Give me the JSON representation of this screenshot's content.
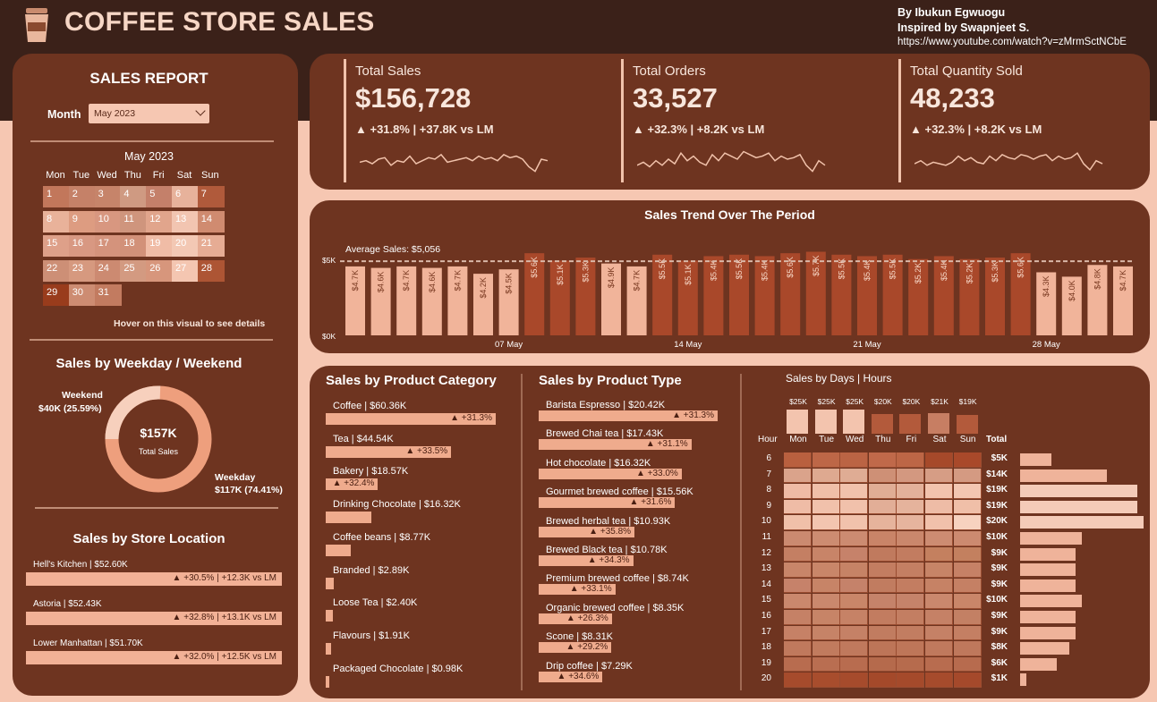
{
  "header": {
    "title": "COFFEE STORE SALES",
    "credit_author": "By Ibukun Egwuogu",
    "credit_inspired": "Inspired by Swapnjeet S.",
    "credit_url": "https://www.youtube.com/watch?v=zMrmSctNCbE",
    "logo_icon": "coffee-cup-icon"
  },
  "report": {
    "title": "SALES REPORT",
    "month_label": "Month",
    "month_value": "May 2023"
  },
  "calendar": {
    "title": "May 2023",
    "weekdays": [
      "Mon",
      "Tue",
      "Wed",
      "Thu",
      "Fri",
      "Sat",
      "Sun"
    ],
    "days": [
      "1",
      "2",
      "3",
      "4",
      "5",
      "6",
      "7",
      "8",
      "9",
      "10",
      "11",
      "12",
      "13",
      "14",
      "15",
      "16",
      "17",
      "18",
      "19",
      "20",
      "21",
      "22",
      "23",
      "24",
      "25",
      "26",
      "27",
      "28",
      "29",
      "30",
      "31"
    ],
    "hint": "Hover on this visual to see details"
  },
  "weekday_weekend": {
    "title": "Sales by Weekday / Weekend",
    "center_value": "$157K",
    "center_label": "Total Sales",
    "weekend_label": "Weekend",
    "weekend_value": "$40K (25.59%)",
    "weekday_label": "Weekday",
    "weekday_value": "$117K (74.41%)",
    "weekend_share": 0.2559
  },
  "store_location": {
    "title": "Sales by Store Location",
    "items": [
      {
        "label": "Hell's Kitchen | $52.60K",
        "delta": "▲ +30.5% | +12.3K vs LM"
      },
      {
        "label": "Astoria | $52.43K",
        "delta": "▲ +32.8% | +13.1K vs LM"
      },
      {
        "label": "Lower Manhattan | $51.70K",
        "delta": "▲ +32.0% | +12.5K vs LM"
      }
    ]
  },
  "kpis": [
    {
      "label": "Total Sales",
      "value": "$156,728",
      "delta": "▲ +31.8% | +37.8K vs LM"
    },
    {
      "label": "Total Orders",
      "value": "33,527",
      "delta": "▲ +32.3% | +8.2K vs LM"
    },
    {
      "label": "Total Quantity Sold",
      "value": "48,233",
      "delta": "▲ +32.3% | +8.2K vs LM"
    }
  ],
  "trend": {
    "title": "Sales Trend Over The Period",
    "avg_label": "Average Sales: $5,056",
    "avg_value": 5.056,
    "ytick_top": "$5K",
    "ytick_bottom": "$0K",
    "bar_labels": [
      "$4.7K",
      "$4.6K",
      "$4.7K",
      "$4.6K",
      "$4.7K",
      "$4.2K",
      "$4.5K",
      "$5.6K",
      "$5.1K",
      "$5.3K",
      "$4.9K",
      "$4.7K",
      "$5.5K",
      "$5.1K",
      "$5.4K",
      "$5.5K",
      "$5.4K",
      "$5.6K",
      "$5.7K",
      "$5.5K",
      "$5.4K",
      "$5.5K",
      "$5.2K",
      "$5.4K",
      "$5.2K",
      "$5.3K",
      "$5.6K",
      "$4.3K",
      "$4.0K",
      "$4.8K",
      "$4.7K"
    ],
    "xticks": [
      "07 May",
      "14 May",
      "21 May",
      "28 May"
    ]
  },
  "chart_data": {
    "type": "bar",
    "title": "Sales Trend Over The Period",
    "x": [
      "1",
      "2",
      "3",
      "4",
      "5",
      "6",
      "7",
      "8",
      "9",
      "10",
      "11",
      "12",
      "13",
      "14",
      "15",
      "16",
      "17",
      "18",
      "19",
      "20",
      "21",
      "22",
      "23",
      "24",
      "25",
      "26",
      "27",
      "28",
      "29",
      "30",
      "31"
    ],
    "values": [
      4.7,
      4.6,
      4.7,
      4.6,
      4.7,
      4.2,
      4.5,
      5.6,
      5.1,
      5.3,
      4.9,
      4.7,
      5.5,
      5.1,
      5.4,
      5.5,
      5.4,
      5.6,
      5.7,
      5.5,
      5.4,
      5.5,
      5.2,
      5.4,
      5.2,
      5.3,
      5.6,
      4.3,
      4.0,
      4.8,
      4.7
    ],
    "ylim": [
      0,
      5.9
    ],
    "unit": "$K",
    "average": 5.056
  },
  "product_category": {
    "title": "Sales by Product Category",
    "items": [
      {
        "label": "Coffee | $60.36K",
        "value": 60.36,
        "delta": "▲ +31.3%"
      },
      {
        "label": "Tea | $44.54K",
        "value": 44.54,
        "delta": "▲ +33.5%"
      },
      {
        "label": "Bakery | $18.57K",
        "value": 18.57,
        "delta": "▲ +32.4%"
      },
      {
        "label": "Drinking Chocolate | $16.32K",
        "value": 16.32,
        "delta": ""
      },
      {
        "label": "Coffee beans | $8.77K",
        "value": 8.77,
        "delta": ""
      },
      {
        "label": "Branded | $2.89K",
        "value": 2.89,
        "delta": ""
      },
      {
        "label": "Loose Tea | $2.40K",
        "value": 2.4,
        "delta": ""
      },
      {
        "label": "Flavours | $1.91K",
        "value": 1.91,
        "delta": ""
      },
      {
        "label": "Packaged Chocolate | $0.98K",
        "value": 0.98,
        "delta": ""
      }
    ]
  },
  "product_type": {
    "title": "Sales by Product Type",
    "items": [
      {
        "label": "Barista Espresso | $20.42K",
        "value": 20.42,
        "delta": "▲ +31.3%"
      },
      {
        "label": "Brewed Chai tea | $17.43K",
        "value": 17.43,
        "delta": "▲ +31.1%"
      },
      {
        "label": "Hot chocolate | $16.32K",
        "value": 16.32,
        "delta": "▲ +33.0%"
      },
      {
        "label": "Gourmet brewed coffee | $15.56K",
        "value": 15.56,
        "delta": "▲ +31.6%"
      },
      {
        "label": "Brewed herbal tea | $10.93K",
        "value": 10.93,
        "delta": "▲ +35.8%"
      },
      {
        "label": "Brewed Black tea | $10.78K",
        "value": 10.78,
        "delta": "▲ +34.3%"
      },
      {
        "label": "Premium brewed coffee | $8.74K",
        "value": 8.74,
        "delta": "▲ +33.1%"
      },
      {
        "label": "Organic brewed coffee | $8.35K",
        "value": 8.35,
        "delta": "▲ +26.3%"
      },
      {
        "label": "Scone | $8.31K",
        "value": 8.31,
        "delta": "▲ +29.2%"
      },
      {
        "label": "Drip coffee | $7.29K",
        "value": 7.29,
        "delta": "▲ +34.6%"
      }
    ]
  },
  "heatmap": {
    "title": "Sales by Days | Hours",
    "hour_header": "Hour",
    "total_header": "Total",
    "days": [
      "Mon",
      "Tue",
      "Wed",
      "Thu",
      "Fri",
      "Sat",
      "Sun"
    ],
    "day_totals": [
      "$25K",
      "$25K",
      "$25K",
      "$20K",
      "$20K",
      "$21K",
      "$19K"
    ],
    "day_values": [
      25,
      25,
      25,
      20,
      20,
      21,
      19
    ],
    "hours": [
      "6",
      "7",
      "8",
      "9",
      "10",
      "11",
      "12",
      "13",
      "14",
      "15",
      "16",
      "17",
      "18",
      "19",
      "20"
    ],
    "hour_totals": [
      "$5K",
      "$14K",
      "$19K",
      "$19K",
      "$20K",
      "$10K",
      "$9K",
      "$9K",
      "$9K",
      "$10K",
      "$9K",
      "$9K",
      "$8K",
      "$6K",
      "$1K"
    ],
    "hour_values": [
      5,
      14,
      19,
      19,
      20,
      10,
      9,
      9,
      9,
      10,
      9,
      9,
      8,
      6,
      1
    ]
  }
}
